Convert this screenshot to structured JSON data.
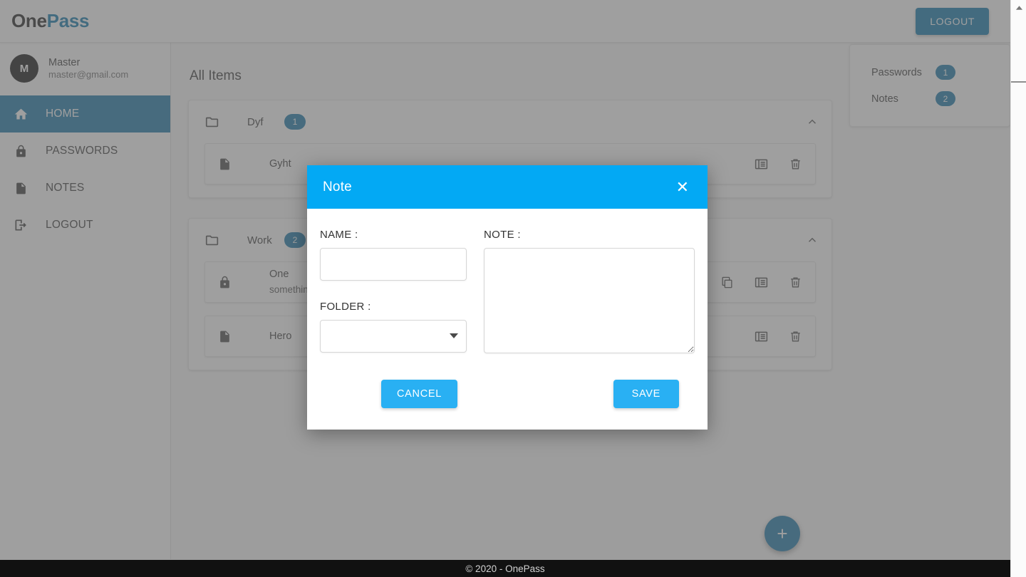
{
  "header": {
    "brand_one": "One",
    "brand_pass": "Pass",
    "logout_label": "LOGOUT"
  },
  "sidebar": {
    "user": {
      "initial": "M",
      "name": "Master",
      "email": "master@gmail.com"
    },
    "items": [
      {
        "label": "HOME",
        "icon": "home-icon",
        "active": true
      },
      {
        "label": "PASSWORDS",
        "icon": "lock-icon",
        "active": false
      },
      {
        "label": "NOTES",
        "icon": "note-icon",
        "active": false
      },
      {
        "label": "LOGOUT",
        "icon": "logout-icon",
        "active": false
      }
    ]
  },
  "main": {
    "page_title": "All Items",
    "folders": [
      {
        "name": "Dyf",
        "count": "1",
        "expanded": true,
        "entries": [
          {
            "title": "Gyht",
            "subtitle": "",
            "type": "note",
            "actions": [
              "view-icon",
              "delete-icon"
            ]
          }
        ]
      },
      {
        "name": "Work",
        "count": "2",
        "expanded": true,
        "entries": [
          {
            "title": "One",
            "subtitle": "something",
            "type": "password",
            "actions": [
              "copy-icon",
              "view-icon",
              "delete-icon"
            ]
          },
          {
            "title": "Hero",
            "subtitle": "",
            "type": "note",
            "actions": [
              "view-icon",
              "delete-icon"
            ]
          }
        ]
      }
    ]
  },
  "right_panel": {
    "stats": [
      {
        "label": "Passwords",
        "count": "1"
      },
      {
        "label": "Notes",
        "count": "2"
      }
    ]
  },
  "fab": {
    "label": "+"
  },
  "footer": {
    "text": "© 2020 - OnePass"
  },
  "modal": {
    "title": "Note",
    "close_label": "✕",
    "name_label": "NAME :",
    "name_value": "",
    "name_placeholder": "",
    "folder_label": "FOLDER :",
    "folder_value": "",
    "folder_options": [
      ""
    ],
    "note_label": "NOTE :",
    "note_value": "",
    "note_placeholder": "",
    "cancel_label": "CANCEL",
    "save_label": "SAVE"
  },
  "colors": {
    "brand_blue": "#0e77ab",
    "accent_blue": "#1878a8",
    "modal_blue": "#03a9f4",
    "button_blue": "#29b0f3",
    "footer_bg": "#111111"
  }
}
